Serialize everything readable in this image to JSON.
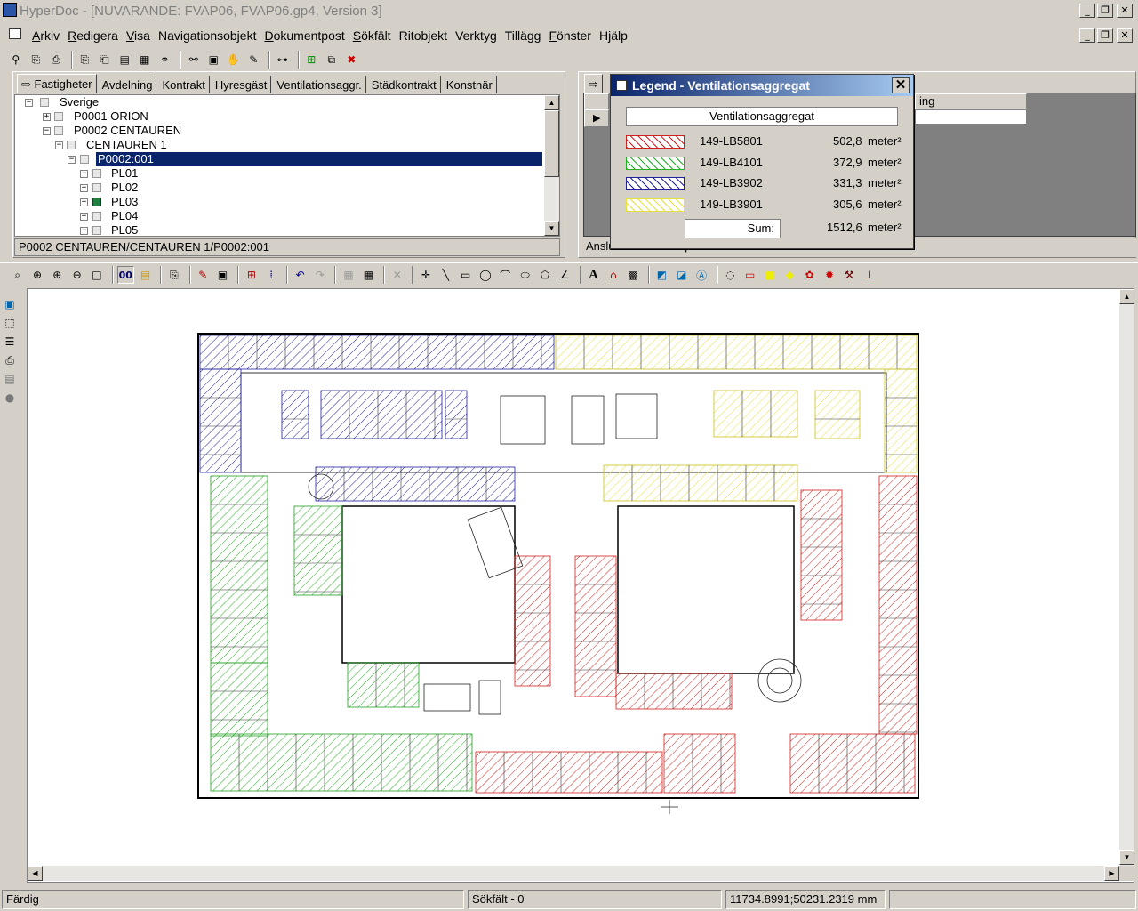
{
  "window": {
    "title": "HyperDoc - [NUVARANDE: FVAP06, FVAP06.gp4, Version 3]"
  },
  "menu": [
    "Arkiv",
    "Redigera",
    "Visa",
    "Navigationsobjekt",
    "Dokumentpost",
    "Sökfält",
    "Ritobjekt",
    "Verktyg",
    "Tillägg",
    "Fönster",
    "Hjälp"
  ],
  "left_tabs": [
    "Fastigheter",
    "Avdelning",
    "Kontrakt",
    "Hyresgäst",
    "Ventilationsaggr.",
    "Städkontrakt",
    "Konstnär"
  ],
  "tree": {
    "nodes": [
      "Sverige",
      "P0001 ORION",
      "P0002 CENTAUREN",
      "CENTAUREN 1",
      "P0002:001",
      "PL01",
      "PL02",
      "PL03",
      "PL04",
      "PL05"
    ],
    "selected": "P0002:001",
    "path": "P0002 CENTAUREN/CENTAUREN 1/P0002:001"
  },
  "right_panel": {
    "grid_header_fragment": "ing",
    "footer_fragment": "Anslutna dokumentposter"
  },
  "legend": {
    "title": "Legend - Ventilationsaggregat",
    "header": "Ventilationsaggregat",
    "unit": "meter²",
    "rows": [
      {
        "name": "149-LB5801",
        "value": "502,8",
        "color": "#d02020"
      },
      {
        "name": "149-LB4101",
        "value": "372,9",
        "color": "#20b020"
      },
      {
        "name": "149-LB3902",
        "value": "331,3",
        "color": "#2020a0"
      },
      {
        "name": "149-LB3901",
        "value": "305,6",
        "color": "#e8e040"
      }
    ],
    "sum_label": "Sum:",
    "sum_value": "1512,6"
  },
  "status": {
    "state": "Färdig",
    "search_field": "Sökfält - 0",
    "coordinates": "11734.8991;50231.2319 mm"
  }
}
